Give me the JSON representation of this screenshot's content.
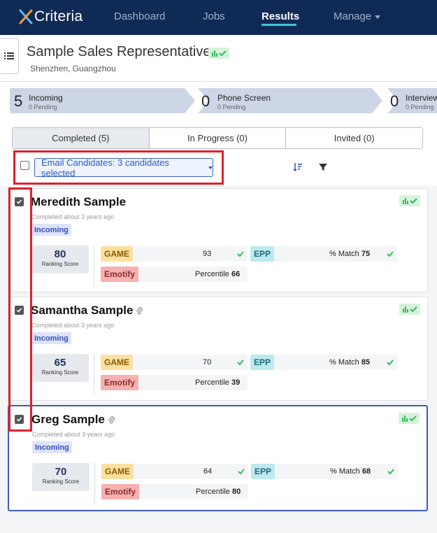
{
  "nav": {
    "brand": "Criteria",
    "items": [
      "Dashboard",
      "Jobs",
      "Results",
      "Manage"
    ],
    "active": "Results"
  },
  "job": {
    "title": "Sample Sales Representative",
    "location": "Shenzhen, Guangzhou"
  },
  "pipeline": [
    {
      "count": "5",
      "name": "Incoming",
      "pending": "0 Pending"
    },
    {
      "count": "0",
      "name": "Phone Screen",
      "pending": "0 Pending"
    },
    {
      "count": "0",
      "name": "Interview",
      "pending": "0 Pending"
    }
  ],
  "tabs": [
    "Completed (5)",
    "In Progress (0)",
    "Invited (0)"
  ],
  "toolbar": {
    "email_button": "Email Candidates: 3 candidates selected",
    "icons": [
      "sort-icon",
      "filter-icon"
    ]
  },
  "candidates": [
    {
      "name": "Meredith Sample",
      "completed": "Completed about 3 years ago",
      "stage": "Incoming",
      "rank": "80",
      "rank_label": "Ranking Score",
      "game_label": "GAME",
      "game_score": "93",
      "emotify_label": "Emotify",
      "emotify_prefix": "Percentile",
      "emotify_score": "66",
      "epp_label": "EPP",
      "epp_prefix": "% Match",
      "epp_score": "75",
      "checked": true,
      "attachment": false
    },
    {
      "name": "Samantha Sample",
      "completed": "Completed about 3 years ago",
      "stage": "Incoming",
      "rank": "65",
      "rank_label": "Ranking Score",
      "game_label": "GAME",
      "game_score": "70",
      "emotify_label": "Emotify",
      "emotify_prefix": "Percentile",
      "emotify_score": "39",
      "epp_label": "EPP",
      "epp_prefix": "% Match",
      "epp_score": "85",
      "checked": true,
      "attachment": true
    },
    {
      "name": "Greg Sample",
      "completed": "Completed about 3 years ago",
      "stage": "Incoming",
      "rank": "70",
      "rank_label": "Ranking Score",
      "game_label": "GAME",
      "game_score": "64",
      "emotify_label": "Emotify",
      "emotify_prefix": "Percentile",
      "emotify_score": "80",
      "epp_label": "EPP",
      "epp_prefix": "% Match",
      "epp_score": "68",
      "checked": true,
      "attachment": true
    }
  ],
  "colors": {
    "nav_bg": "#102a56",
    "accent": "#3fc6d4",
    "highlight": "#e0202a",
    "selected_border": "#3e5bb5",
    "check": "#2fbf5a"
  }
}
